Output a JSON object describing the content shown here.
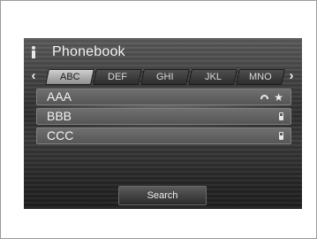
{
  "header": {
    "title": "Phonebook",
    "info_icon": "info-icon"
  },
  "tabs": {
    "prev_icon": "‹",
    "next_icon": "›",
    "items": [
      {
        "label": "ABC",
        "active": true
      },
      {
        "label": "DEF",
        "active": false
      },
      {
        "label": "GHI",
        "active": false
      },
      {
        "label": "JKL",
        "active": false
      },
      {
        "label": "MNO",
        "active": false
      }
    ]
  },
  "contacts": [
    {
      "name": "AAA",
      "icons": [
        "phone-icon",
        "star-icon"
      ]
    },
    {
      "name": "BBB",
      "icons": [
        "mobile-icon"
      ]
    },
    {
      "name": "CCC",
      "icons": [
        "mobile-icon"
      ]
    }
  ],
  "search_label": "Search",
  "colors": {
    "screen_dark": "#2f2f2f",
    "active_tab": "#cfcfcf",
    "row": "#6f6f6f"
  }
}
